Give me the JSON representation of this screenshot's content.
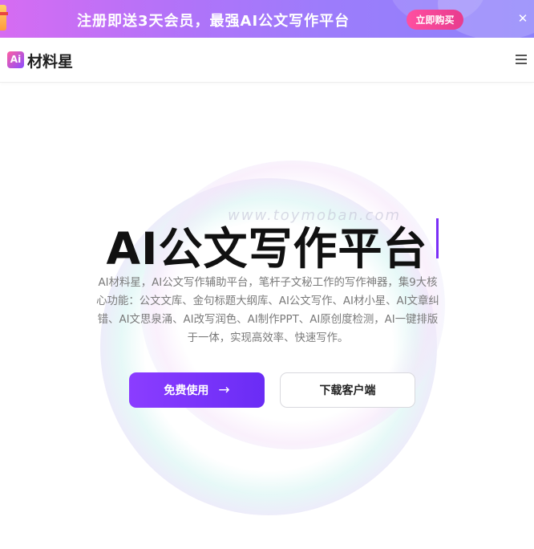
{
  "promo": {
    "text": "注册即送3天会员，最强AI公文写作平台",
    "button_label": "立即购买",
    "close_glyph": "✕"
  },
  "nav": {
    "logo_mark": "Ai",
    "brand": "材料星",
    "menu_icon": "menu-icon"
  },
  "hero": {
    "watermark": "www.toymoban.com",
    "title": "AI公文写作平台",
    "description": "AI材料星，AI公文写作辅助平台，笔杆子文秘工作的写作神器，集9大核心功能：公文文库、金句标题大纲库、AI公文写作、AI材小星、AI文章纠错、AI文思泉涌、AI改写润色、AI制作PPT、AI原创度检测，AI一键排版于一体，实现高效率、快速写作。",
    "primary_button": "免费使用",
    "primary_arrow": "→",
    "secondary_button": "下载客户端"
  },
  "colors": {
    "accent": "#7b2ff7",
    "promo_start": "#d66cf2",
    "promo_end": "#8d82fb",
    "buy_button": "#e83c8e"
  }
}
